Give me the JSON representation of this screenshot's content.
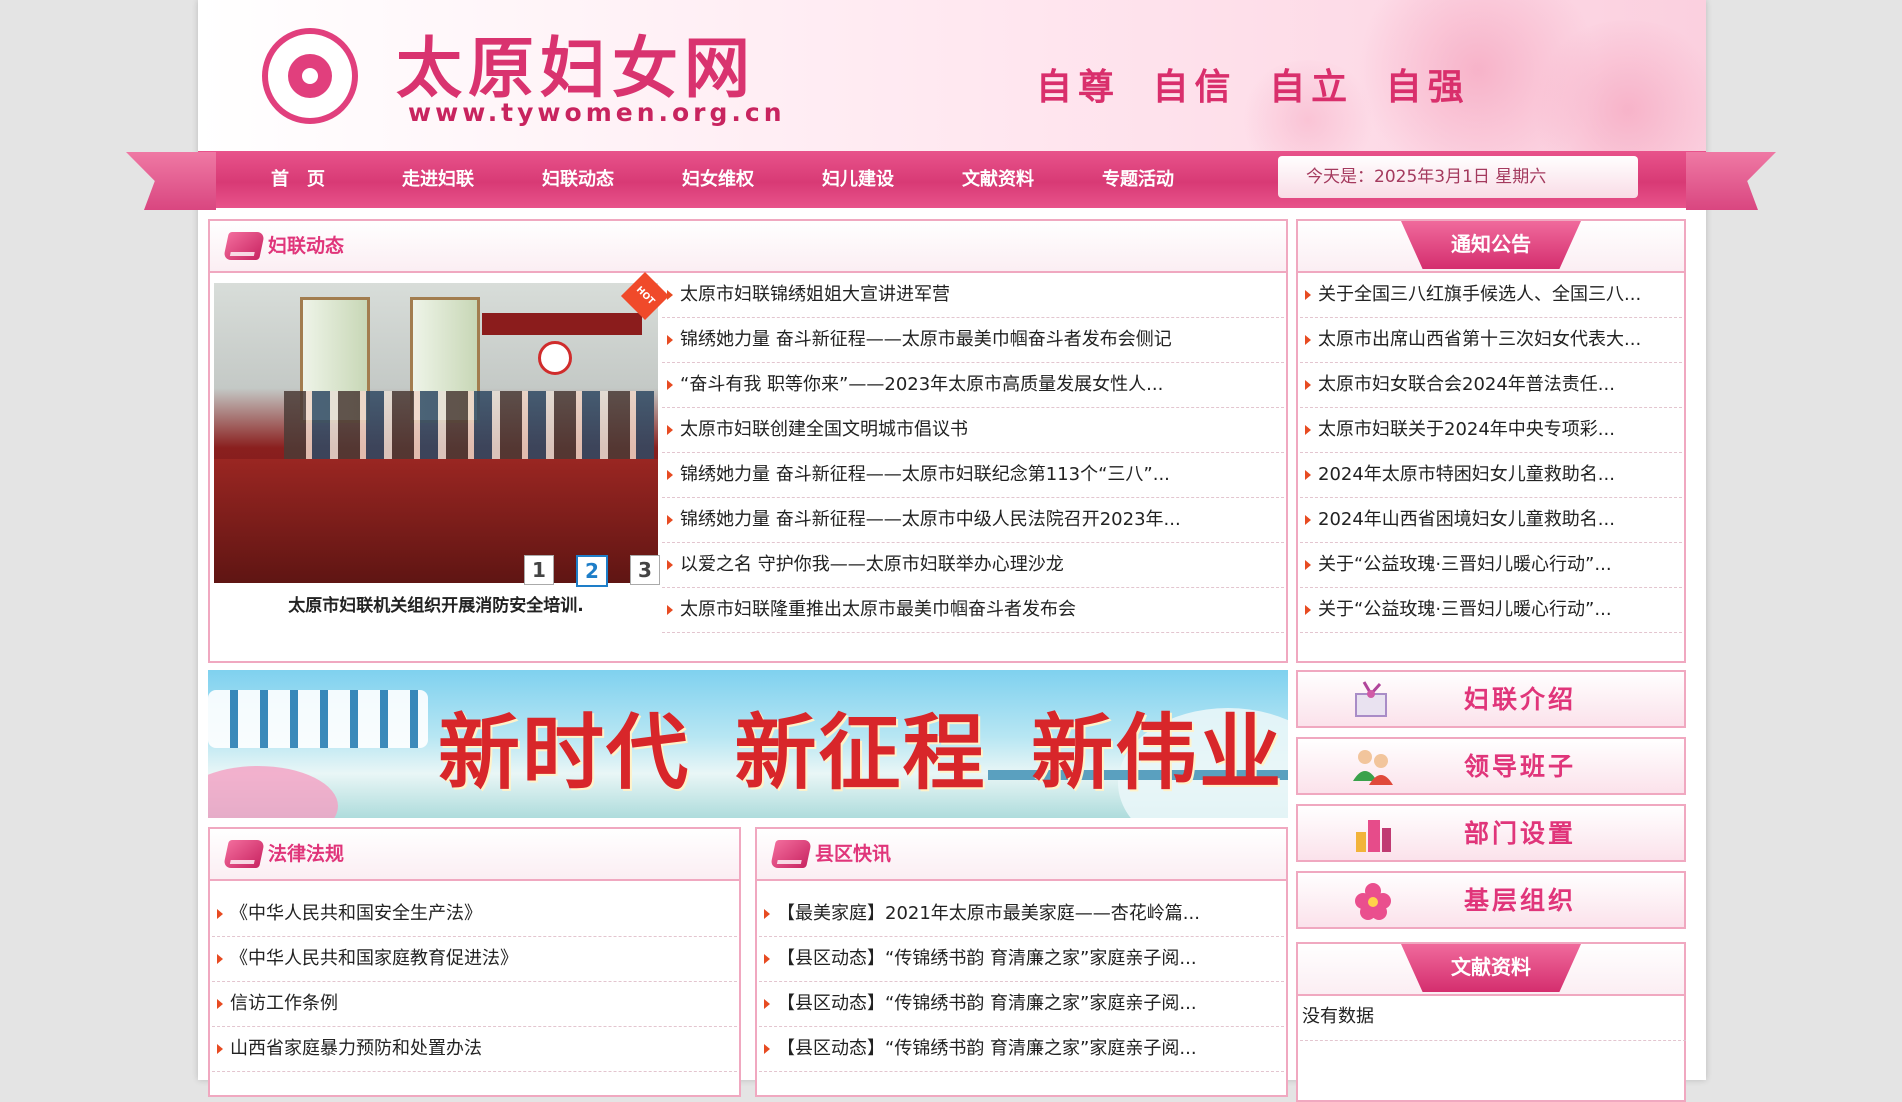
{
  "header": {
    "site_title": "太原妇女网",
    "site_url": "www.tywomen.org.cn",
    "slogan": "自尊 自信 自立 自强"
  },
  "nav": {
    "items": [
      "首　页",
      "走进妇联",
      "妇联动态",
      "妇女维权",
      "妇儿建设",
      "文献资料",
      "专题活动"
    ],
    "date_text": "今天是：2025年3月1日 星期六"
  },
  "news": {
    "title": "妇联动态",
    "hot_badge": "HOT",
    "photo_caption": "太原市妇联机关组织开展消防安全培训.",
    "slides": [
      "1",
      "2",
      "3"
    ],
    "active_slide": 2,
    "items": [
      "太原市妇联锦绣姐姐大宣讲进军营",
      "锦绣她力量 奋斗新征程——太原市最美巾帼奋斗者发布会侧记",
      "“奋斗有我 职等你来”——2023年太原市高质量发展女性人...",
      "太原市妇联创建全国文明城市倡议书",
      "锦绣她力量 奋斗新征程——太原市妇联纪念第113个“三八”...",
      "锦绣她力量 奋斗新征程——太原市中级人民法院召开2023年...",
      "以爱之名 守护你我——太原市妇联举办心理沙龙",
      "太原市妇联隆重推出太原市最美巾帼奋斗者发布会"
    ]
  },
  "notice": {
    "title": "通知公告",
    "items": [
      "关于全国三八红旗手候选人、全国三八...",
      "太原市出席山西省第十三次妇女代表大...",
      "太原市妇女联合会2024年普法责任...",
      "太原市妇联关于2024年中央专项彩...",
      "2024年太原市特困妇女儿童救助名...",
      "2024年山西省困境妇女儿童救助名...",
      "关于“公益玫瑰·三晋妇儿暖心行动”...",
      "关于“公益玫瑰·三晋妇儿暖心行动”..."
    ]
  },
  "banner": {
    "text": "新时代 新征程 新伟业"
  },
  "side_buttons": [
    "妇联介绍",
    "领导班子",
    "部门设置",
    "基层组织"
  ],
  "law": {
    "title": "法律法规",
    "items": [
      "《中华人民共和国安全生产法》",
      "《中华人民共和国家庭教育促进法》",
      "信访工作条例",
      "山西省家庭暴力预防和处置办法"
    ]
  },
  "county": {
    "title": "县区快讯",
    "items": [
      "【最美家庭】2021年太原市最美家庭——杏花岭篇...",
      "【县区动态】“传锦绣书韵 育清廉之家”家庭亲子阅...",
      "【县区动态】“传锦绣书韵 育清廉之家”家庭亲子阅...",
      "【县区动态】“传锦绣书韵 育清廉之家”家庭亲子阅..."
    ]
  },
  "docs": {
    "title": "文献资料",
    "empty_text": "没有数据"
  },
  "colors": {
    "accent": "#e0357a",
    "nav": "#d83a75",
    "border": "#f0a8c0",
    "arrow": "#e74b22"
  }
}
